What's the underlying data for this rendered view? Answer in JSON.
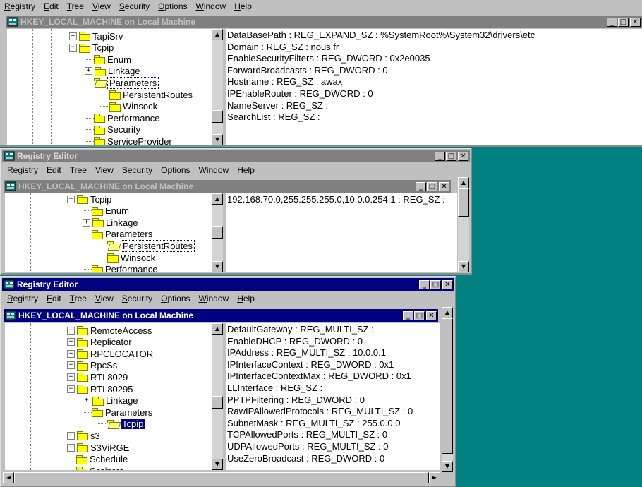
{
  "menus": [
    "Registry",
    "Edit",
    "Tree",
    "View",
    "Security",
    "Options",
    "Window",
    "Help"
  ],
  "icons": {
    "title": "registry-icon",
    "minimize": "minimize-icon",
    "maximize": "maximize-icon",
    "close": "close-icon"
  },
  "glyphs": {
    "minimize": "_",
    "maximize": "□",
    "close": "✕",
    "up": "▲",
    "down": "▼",
    "left": "◄",
    "right": "►",
    "plus": "+",
    "minus": "−"
  },
  "window1": {
    "child_title": "HKEY_LOCAL_MACHINE on Local Machine",
    "tree": [
      {
        "label": "TapiSrv",
        "box": "plus"
      },
      {
        "label": "Tcpip",
        "box": "minus"
      },
      {
        "label": "Enum"
      },
      {
        "label": "Linkage",
        "box": "plus"
      },
      {
        "label": "Parameters",
        "open": true,
        "selected": true
      },
      {
        "label": "PersistentRoutes"
      },
      {
        "label": "Winsock"
      },
      {
        "label": "Performance"
      },
      {
        "label": "Security"
      },
      {
        "label": "ServiceProvider"
      }
    ],
    "values": [
      "DataBasePath : REG_EXPAND_SZ : %SystemRoot%\\System32\\drivers\\etc",
      "Domain : REG_SZ : nous.fr",
      "EnableSecurityFilters : REG_DWORD : 0x2e0035",
      "ForwardBroadcasts : REG_DWORD : 0",
      "Hostname : REG_SZ : awax",
      "IPEnableRouter : REG_DWORD : 0",
      "NameServer : REG_SZ :",
      "SearchList : REG_SZ :"
    ]
  },
  "window2": {
    "title": "Registry Editor",
    "child_title": "HKEY_LOCAL_MACHINE on Local Machine",
    "tree": [
      {
        "label": "Tcpip",
        "box": "minus"
      },
      {
        "label": "Enum"
      },
      {
        "label": "Linkage",
        "box": "plus"
      },
      {
        "label": "Parameters"
      },
      {
        "label": "PersistentRoutes",
        "open": true,
        "selected": true
      },
      {
        "label": "Winsock"
      },
      {
        "label": "Performance"
      }
    ],
    "values": [
      "192.168.70.0,255.255.255.0,10.0.0.254,1 : REG_SZ :"
    ]
  },
  "window3": {
    "title": "Registry Editor",
    "child_title": "HKEY_LOCAL_MACHINE on Local Machine",
    "tree": [
      {
        "label": "RemoteAccess",
        "box": "plus"
      },
      {
        "label": "Replicator",
        "box": "plus"
      },
      {
        "label": "RPCLOCATOR",
        "box": "plus"
      },
      {
        "label": "RpcSs",
        "box": "plus"
      },
      {
        "label": "RTL8029",
        "box": "plus"
      },
      {
        "label": "RTL80295",
        "box": "minus"
      },
      {
        "label": "Linkage",
        "box": "plus"
      },
      {
        "label": "Parameters"
      },
      {
        "label": "Tcpip",
        "open": true,
        "highlight": true
      },
      {
        "label": "s3",
        "box": "plus"
      },
      {
        "label": "S3ViRGE",
        "box": "plus"
      },
      {
        "label": "Schedule"
      },
      {
        "label": "Scsiprnt"
      }
    ],
    "values": [
      "DefaultGateway : REG_MULTI_SZ :",
      "EnableDHCP : REG_DWORD : 0",
      "IPAddress : REG_MULTI_SZ : 10.0.0.1",
      "IPInterfaceContext : REG_DWORD : 0x1",
      "IPInterfaceContextMax : REG_DWORD : 0x1",
      "LLInterface : REG_SZ :",
      "PPTPFiltering : REG_DWORD : 0",
      "RawIPAllowedProtocols : REG_MULTI_SZ : 0",
      "SubnetMask : REG_MULTI_SZ : 255.0.0.0",
      "TCPAllowedPorts : REG_MULTI_SZ : 0",
      "UDPAllowedPorts : REG_MULTI_SZ : 0",
      "UseZeroBroadcast : REG_DWORD : 0"
    ]
  }
}
